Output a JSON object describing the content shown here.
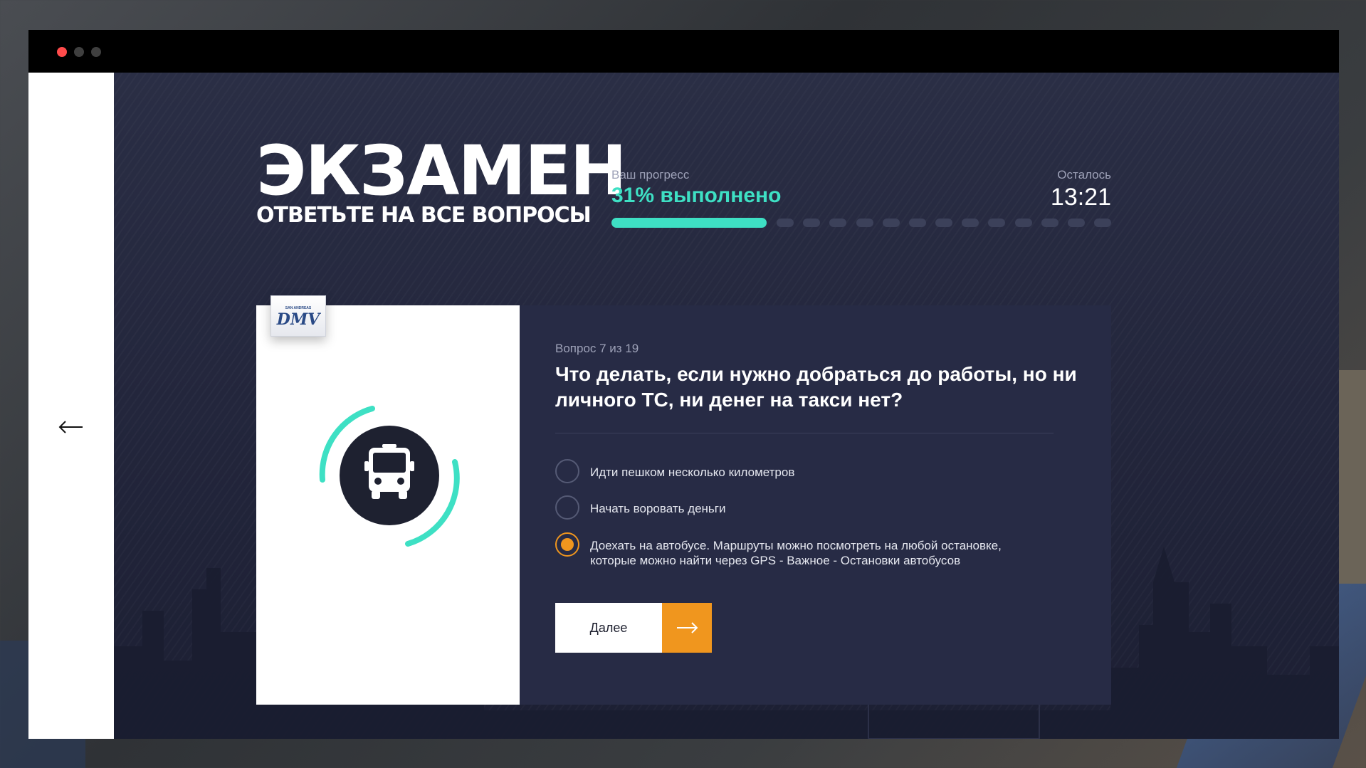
{
  "exam": {
    "title": "ЭКЗАМЕН",
    "subtitle": "ОТВЕТЬТЕ НА ВСЕ ВОПРОСЫ"
  },
  "progress": {
    "label": "Ваш прогресс",
    "value_text": "31% выполнено",
    "percent": 31,
    "remaining_steps": 13
  },
  "timer": {
    "label": "Осталось",
    "value": "13:21"
  },
  "badge": {
    "small_text": "SAN ANDREAS",
    "logo_text": "DMV"
  },
  "question": {
    "counter": "Вопрос 7 из 19",
    "text": "Что делать, если нужно добраться до работы, но ни личного ТС, ни денег на такси нет?",
    "icon": "bus-icon",
    "options": [
      {
        "label": "Идти пешком несколько километров",
        "selected": false
      },
      {
        "label": "Начать воровать деньги",
        "selected": false
      },
      {
        "label": "Доехать на автобусе. Маршруты можно посмотреть на любой остановке, которые можно найти через GPS - Важное - Остановки автобусов",
        "selected": true
      }
    ]
  },
  "buttons": {
    "next_label": "Далее"
  },
  "colors": {
    "accent": "#3ee0c4",
    "orange": "#f0961e",
    "panel": "#272b45",
    "background": "#23263c"
  }
}
